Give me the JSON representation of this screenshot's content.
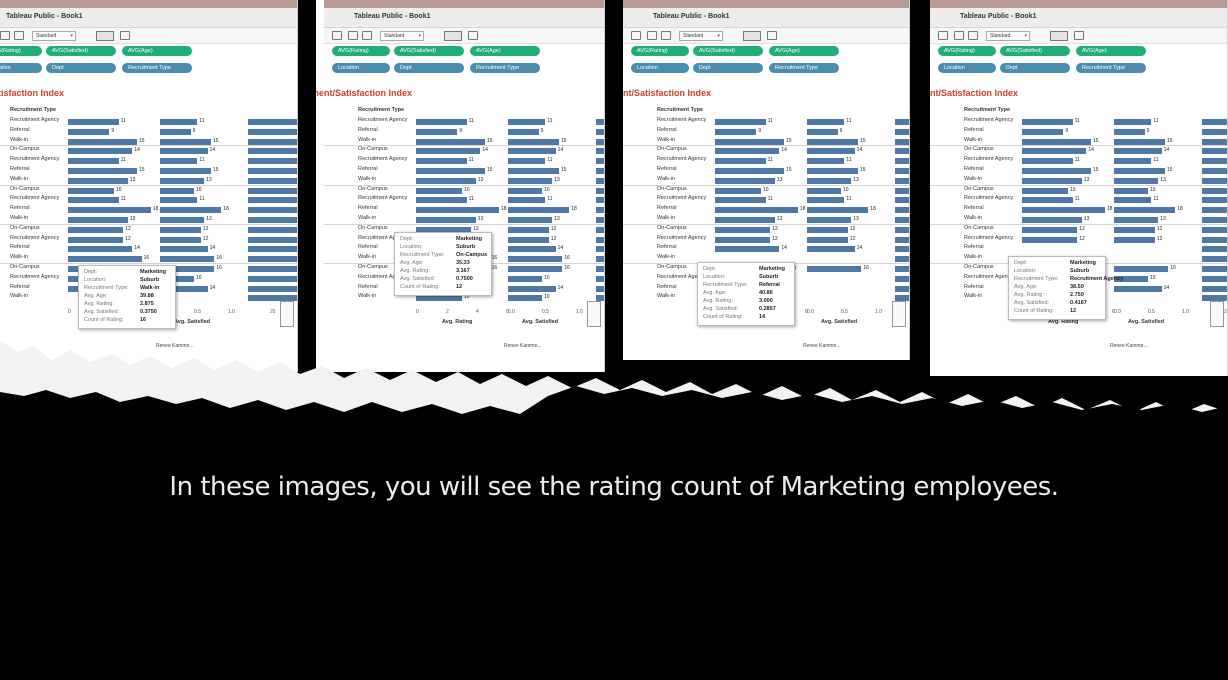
{
  "caption": "In these images, you will see the rating count of Marketing employees.",
  "workbook_title": "Tableau Public - Book1",
  "toolbar": {
    "view_mode": "Standard"
  },
  "shelves": {
    "green_pills": [
      "AVG(Rating)",
      "AVG(Satisfied)",
      "AVG(Age)"
    ],
    "blue_pills": [
      "Location",
      "Dept",
      "Recruitment Type"
    ]
  },
  "viz_title": "Recruitment/Satisfaction Index",
  "column_header": "Recruitment Type",
  "axes": {
    "rating": {
      "title": "Avg. Rating",
      "ticks": [
        "0",
        "2",
        "4",
        "6"
      ]
    },
    "satisfied": {
      "title": "Avg. Satisfied",
      "ticks": [
        "0.0",
        "0.5",
        "1.0"
      ]
    },
    "age": {
      "tick": "20"
    }
  },
  "status_user": "Renee Kamme...",
  "panels": [
    {
      "rows": [
        {
          "dept": "",
          "rtype": "Recruitment Agency",
          "value": 11
        },
        {
          "dept": "",
          "rtype": "Referral",
          "value": 9
        },
        {
          "dept": "",
          "rtype": "Walk-in",
          "value": 15
        },
        {
          "dept": "On-Campus",
          "rtype": "",
          "value": 14
        },
        {
          "dept": "",
          "rtype": "Recruitment Agency",
          "value": 11
        },
        {
          "dept": "",
          "rtype": "Referral",
          "value": 15
        },
        {
          "dept": "",
          "rtype": "Walk-in",
          "value": 13
        },
        {
          "dept": "On-Campus",
          "rtype": "",
          "value": 10
        },
        {
          "dept": "",
          "rtype": "Recruitment Agency",
          "value": 11
        },
        {
          "dept": "",
          "rtype": "Referral",
          "value": 18
        },
        {
          "dept": "",
          "rtype": "Walk-in",
          "value": 13
        },
        {
          "dept": "On-Campus",
          "rtype": "",
          "value": 12
        },
        {
          "dept": "",
          "rtype": "Recruitment Agency",
          "value": 12
        },
        {
          "dept": "",
          "rtype": "Referral",
          "value": 14
        },
        {
          "dept": "",
          "rtype": "Walk-in",
          "value": 16
        },
        {
          "dept": "On-Campus",
          "rtype": "",
          "value": 16
        },
        {
          "dept": "",
          "rtype": "Recruitment Agency",
          "value": 10
        },
        {
          "dept": "",
          "rtype": "Referral",
          "value": 14
        },
        {
          "dept": "",
          "rtype": "Walk-in",
          "value": ""
        }
      ],
      "tooltip": {
        "dept": "Marketing",
        "location": "Suburb",
        "recruitment_type": "Walk-in",
        "avg_age": "39.88",
        "avg_rating": "2.875",
        "avg_satisfied": "0.3750",
        "count_of_rating": "16"
      }
    },
    {
      "rows": [
        {
          "dept": "",
          "rtype": "Recruitment Agency",
          "value": 11
        },
        {
          "dept": "",
          "rtype": "Referral",
          "value": 9
        },
        {
          "dept": "",
          "rtype": "Walk-in",
          "value": 15
        },
        {
          "dept": "On-Campus",
          "rtype": "",
          "value": 14
        },
        {
          "dept": "",
          "rtype": "Recruitment Agency",
          "value": 11
        },
        {
          "dept": "",
          "rtype": "Referral",
          "value": 15
        },
        {
          "dept": "",
          "rtype": "Walk-in",
          "value": 13
        },
        {
          "dept": "On-Campus",
          "rtype": "",
          "value": 10
        },
        {
          "dept": "",
          "rtype": "Recruitment Agency",
          "value": 11
        },
        {
          "dept": "",
          "rtype": "Referral",
          "value": 18
        },
        {
          "dept": "",
          "rtype": "Walk-in",
          "value": 13
        },
        {
          "dept": "On-Campus",
          "rtype": "",
          "value": 12
        },
        {
          "dept": "",
          "rtype": "Recruitment Agency",
          "value": 12
        },
        {
          "dept": "",
          "rtype": "Referral",
          "value": 14
        },
        {
          "dept": "",
          "rtype": "Walk-in",
          "value": 16
        },
        {
          "dept": "On-Campus",
          "rtype": "",
          "value": 16
        },
        {
          "dept": "",
          "rtype": "Recruitment Agency",
          "value": 10
        },
        {
          "dept": "",
          "rtype": "Referral",
          "value": 14
        },
        {
          "dept": "",
          "rtype": "Walk-in",
          "value": 10
        }
      ],
      "tooltip": {
        "dept": "Marketing",
        "location": "Suburb",
        "recruitment_type": "On-Campus",
        "avg_age": "35.33",
        "avg_rating": "3.167",
        "avg_satisfied": "0.7500",
        "count_of_rating": "12"
      }
    },
    {
      "rows": [
        {
          "dept": "",
          "rtype": "Recruitment Agency",
          "value": 11
        },
        {
          "dept": "",
          "rtype": "Referral",
          "value": 9
        },
        {
          "dept": "",
          "rtype": "Walk-in",
          "value": 15
        },
        {
          "dept": "On-Campus",
          "rtype": "",
          "value": 14
        },
        {
          "dept": "",
          "rtype": "Recruitment Agency",
          "value": 11
        },
        {
          "dept": "",
          "rtype": "Referral",
          "value": 15
        },
        {
          "dept": "",
          "rtype": "Walk-in",
          "value": 13
        },
        {
          "dept": "On-Campus",
          "rtype": "",
          "value": 10
        },
        {
          "dept": "",
          "rtype": "Recruitment Agency",
          "value": 11
        },
        {
          "dept": "",
          "rtype": "Referral",
          "value": 18
        },
        {
          "dept": "",
          "rtype": "Walk-in",
          "value": 13
        },
        {
          "dept": "On-Campus",
          "rtype": "",
          "value": 12
        },
        {
          "dept": "",
          "rtype": "Recruitment Agency",
          "value": 12
        },
        {
          "dept": "",
          "rtype": "Referral",
          "value": 14
        },
        {
          "dept": "",
          "rtype": "Walk-in",
          "value": ""
        },
        {
          "dept": "On-Campus",
          "rtype": "",
          "value": 16
        },
        {
          "dept": "",
          "rtype": "Recruitment Agency",
          "value": ""
        },
        {
          "dept": "",
          "rtype": "Referral",
          "value": ""
        },
        {
          "dept": "",
          "rtype": "Walk-in",
          "value": ""
        }
      ],
      "tooltip": {
        "dept": "Marketing",
        "location": "Suburb",
        "recruitment_type": "Referral",
        "avg_age": "40.86",
        "avg_rating": "3.000",
        "avg_satisfied": "0.2857",
        "count_of_rating": "14"
      }
    },
    {
      "rows": [
        {
          "dept": "",
          "rtype": "Recruitment Agency",
          "value": 11
        },
        {
          "dept": "",
          "rtype": "Referral",
          "value": 9
        },
        {
          "dept": "",
          "rtype": "Walk-in",
          "value": 15
        },
        {
          "dept": "On-Campus",
          "rtype": "",
          "value": 14
        },
        {
          "dept": "",
          "rtype": "Recruitment Agency",
          "value": 11
        },
        {
          "dept": "",
          "rtype": "Referral",
          "value": 15
        },
        {
          "dept": "",
          "rtype": "Walk-in",
          "value": 13
        },
        {
          "dept": "On-Campus",
          "rtype": "",
          "value": 10
        },
        {
          "dept": "",
          "rtype": "Recruitment Agency",
          "value": 11
        },
        {
          "dept": "",
          "rtype": "Referral",
          "value": 18
        },
        {
          "dept": "",
          "rtype": "Walk-in",
          "value": 13
        },
        {
          "dept": "On-Campus",
          "rtype": "",
          "value": 12
        },
        {
          "dept": "",
          "rtype": "Recruitment Agency",
          "value": 12
        },
        {
          "dept": "",
          "rtype": "Referral",
          "value": ""
        },
        {
          "dept": "",
          "rtype": "Walk-in",
          "value": ""
        },
        {
          "dept": "On-Campus",
          "rtype": "",
          "value": 16
        },
        {
          "dept": "",
          "rtype": "Recruitment Agency",
          "value": 10
        },
        {
          "dept": "",
          "rtype": "Referral",
          "value": 14
        },
        {
          "dept": "",
          "rtype": "Walk-in",
          "value": ""
        }
      ],
      "tooltip": {
        "dept": "Marketing",
        "location": "Suburb",
        "recruitment_type": "Recruitment Agency",
        "avg_age": "38.50",
        "avg_rating": "2.750",
        "avg_satisfied": "0.4167",
        "count_of_rating": "12"
      }
    }
  ],
  "tooltip_labels": {
    "dept": "Dept:",
    "location": "Location:",
    "recruitment_type": "Recruitment Type:",
    "avg_age": "Avg. Age:",
    "avg_rating": "Avg. Rating:",
    "avg_satisfied": "Avg. Satisfied:",
    "count_of_rating": "Count of Rating:"
  },
  "colors": {
    "bar": "#4e79a7",
    "pill_green": "#1fae78",
    "pill_blue": "#4b8db0",
    "title_red": "#d23b2b"
  }
}
